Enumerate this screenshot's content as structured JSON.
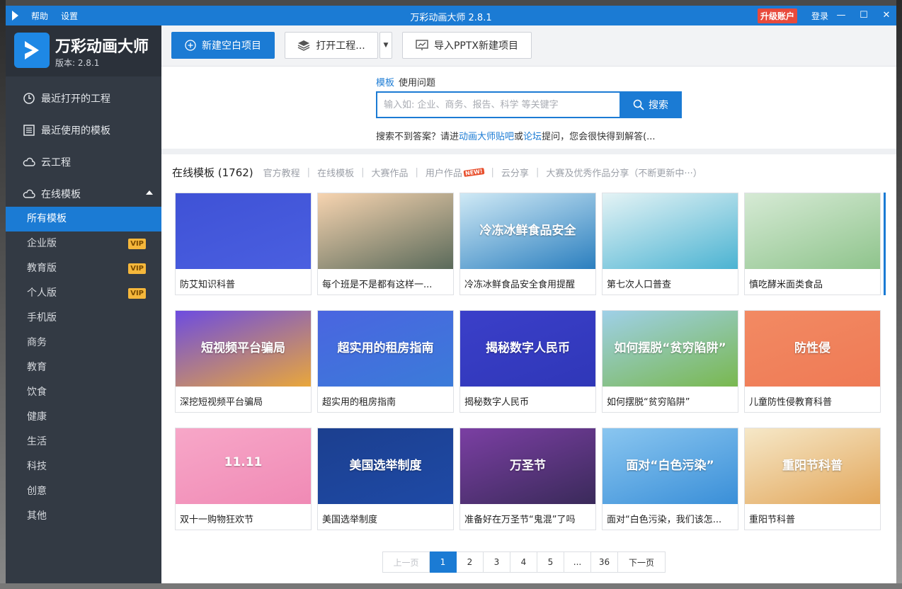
{
  "titlebar": {
    "menu": [
      "帮助",
      "设置"
    ],
    "title": "万彩动画大师 2.8.1",
    "upgrade": "升级账户",
    "login": "登录"
  },
  "brand": {
    "name": "万彩动画大师",
    "version": "版本: 2.8.1"
  },
  "sidebar": {
    "main": [
      {
        "label": "最近打开的工程",
        "icon": "clock-icon"
      },
      {
        "label": "最近使用的模板",
        "icon": "template-icon"
      },
      {
        "label": "云工程",
        "icon": "cloud-icon"
      },
      {
        "label": "在线模板",
        "icon": "cloud-icon"
      }
    ],
    "sub": [
      {
        "label": "所有模板",
        "vip": ""
      },
      {
        "label": "企业版",
        "vip": "VIP"
      },
      {
        "label": "教育版",
        "vip": "VIP"
      },
      {
        "label": "个人版",
        "vip": "VIP"
      },
      {
        "label": "手机版",
        "vip": ""
      },
      {
        "label": "商务",
        "vip": ""
      },
      {
        "label": "教育",
        "vip": ""
      },
      {
        "label": "饮食",
        "vip": ""
      },
      {
        "label": "健康",
        "vip": ""
      },
      {
        "label": "生活",
        "vip": ""
      },
      {
        "label": "科技",
        "vip": ""
      },
      {
        "label": "创意",
        "vip": ""
      },
      {
        "label": "其他",
        "vip": ""
      }
    ]
  },
  "toolbar": {
    "new_blank": "新建空白项目",
    "open_project": "打开工程...",
    "import_pptx": "导入PPTX新建项目"
  },
  "search": {
    "tab_template": "模板",
    "tab_question": "使用问题",
    "placeholder": "输入如: 企业、商务、报告、科学 等关键字",
    "button": "搜索",
    "hint_prefix": "搜索不到答案？请进",
    "hint_link1": "动画大师贴吧",
    "hint_mid": "或",
    "hint_link2": "论坛",
    "hint_suffix": "提问，您会很快得到解答(..."
  },
  "categories": {
    "head": "在线模板 (1762)",
    "items": [
      "官方教程",
      "在线模板",
      "大赛作品",
      "用户作品",
      "云分享",
      "大赛及优秀作品分享（不断更新中···）"
    ],
    "new_tag": "NEW!"
  },
  "templates": [
    {
      "caption": "防艾知识科普",
      "thumb_text": "",
      "bg1": "#3f52d6",
      "bg2": "#4a5fe0"
    },
    {
      "caption": "每个班是不是都有这样一...",
      "thumb_text": "",
      "bg1": "#f7d4b0",
      "bg2": "#5a6a5a"
    },
    {
      "caption": "冷冻冰鲜食品安全食用提醒",
      "thumb_text": "冷冻冰鲜食品安全",
      "bg1": "#cfe9f5",
      "bg2": "#2b7fbf"
    },
    {
      "caption": "第七次人口普查",
      "thumb_text": "",
      "bg1": "#e4f3f5",
      "bg2": "#4bb3d2"
    },
    {
      "caption": "慎吃酵米面类食品",
      "thumb_text": "",
      "bg1": "#d6ead5",
      "bg2": "#8fc48c"
    },
    {
      "caption": "深挖短视频平台骗局",
      "thumb_text": "短视频平台骗局",
      "bg1": "#6d4ce0",
      "bg2": "#e9a73b"
    },
    {
      "caption": "超实用的租房指南",
      "thumb_text": "超实用的租房指南",
      "bg1": "#4a65e0",
      "bg2": "#3b7bd9"
    },
    {
      "caption": "揭秘数字人民币",
      "thumb_text": "揭秘数字人民币",
      "bg1": "#3b3fc9",
      "bg2": "#2f37b8"
    },
    {
      "caption": "如何摆脱“贫穷陷阱”",
      "thumb_text": "如何摆脱“贫穷陷阱”",
      "bg1": "#9fd0e8",
      "bg2": "#79b84f"
    },
    {
      "caption": "儿童防性侵教育科普",
      "thumb_text": "防性侵",
      "bg1": "#f28a63",
      "bg2": "#ef7a55"
    },
    {
      "caption": "双十一购物狂欢节",
      "thumb_text": "11.11",
      "bg1": "#f7a7c8",
      "bg2": "#f08ab5"
    },
    {
      "caption": "美国选举制度",
      "thumb_text": "美国选举制度",
      "bg1": "#1c3f8f",
      "bg2": "#1e4aa6"
    },
    {
      "caption": "准备好在万圣节“鬼混”了吗",
      "thumb_text": "万圣节",
      "bg1": "#7b3fa3",
      "bg2": "#3a2a5a"
    },
    {
      "caption": "面对“白色污染，我们该怎...",
      "thumb_text": "面对“白色污染”",
      "bg1": "#8ac6f0",
      "bg2": "#3a8fd8"
    },
    {
      "caption": "重阳节科普",
      "thumb_text": "重阳节科普",
      "bg1": "#f6e8c8",
      "bg2": "#e2a65a"
    }
  ],
  "pager": {
    "prev": "上一页",
    "pages": [
      "1",
      "2",
      "3",
      "4",
      "5",
      "...",
      "36"
    ],
    "current": "1",
    "next": "下一页"
  }
}
